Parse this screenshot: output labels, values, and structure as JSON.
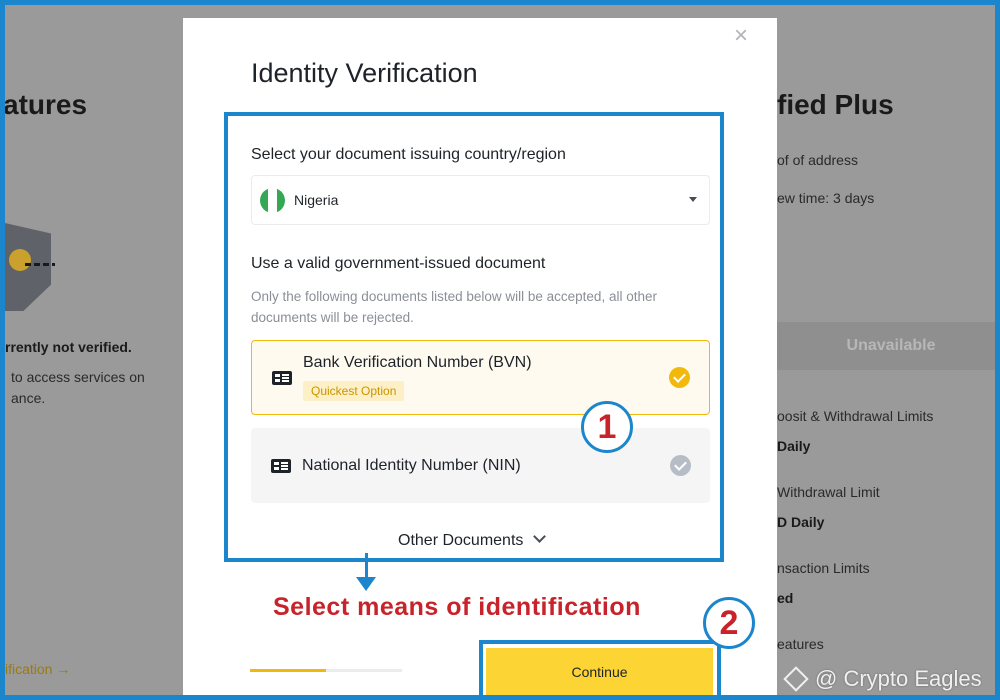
{
  "background": {
    "left": {
      "title_partial": "atures",
      "status_partial": "rrently not verified.",
      "desc_line1": "to access services on",
      "desc_line2": "ance.",
      "link_partial": "ification →"
    },
    "right": {
      "title_partial": "fied Plus",
      "item1": "of of address",
      "item2": "ew time: 3 days",
      "unavailable": "Unavailable",
      "limit1_label": "oosit & Withdrawal Limits",
      "limit1_value": "Daily",
      "limit2_label": "Withdrawal Limit",
      "limit2_value": "D Daily",
      "limit3_label": "nsaction Limits",
      "limit3_value": "ed",
      "features_label": "eatures"
    }
  },
  "modal": {
    "title": "Identity Verification",
    "country_label": "Select your document issuing country/region",
    "country_value": "Nigeria",
    "doc_label": "Use a valid government-issued document",
    "doc_hint": "Only the following documents listed below will be accepted, all other documents will be rejected.",
    "options": [
      {
        "label": "Bank Verification Number (BVN)",
        "badge": "Quickest Option",
        "selected": true
      },
      {
        "label": "National Identity Number (NIN)",
        "selected": false
      }
    ],
    "other_docs": "Other Documents",
    "progress": 0.5,
    "continue_label": "Continue"
  },
  "annotations": {
    "step1": "1",
    "step2": "2",
    "caption": "Select means of identification",
    "watermark": "@ Crypto Eagles"
  },
  "colors": {
    "brand_yellow": "#fcd535",
    "accent": "#f0b90b",
    "annotation_blue": "#1b86cc",
    "annotation_red": "#c8232a",
    "flag_green": "#34a853"
  }
}
